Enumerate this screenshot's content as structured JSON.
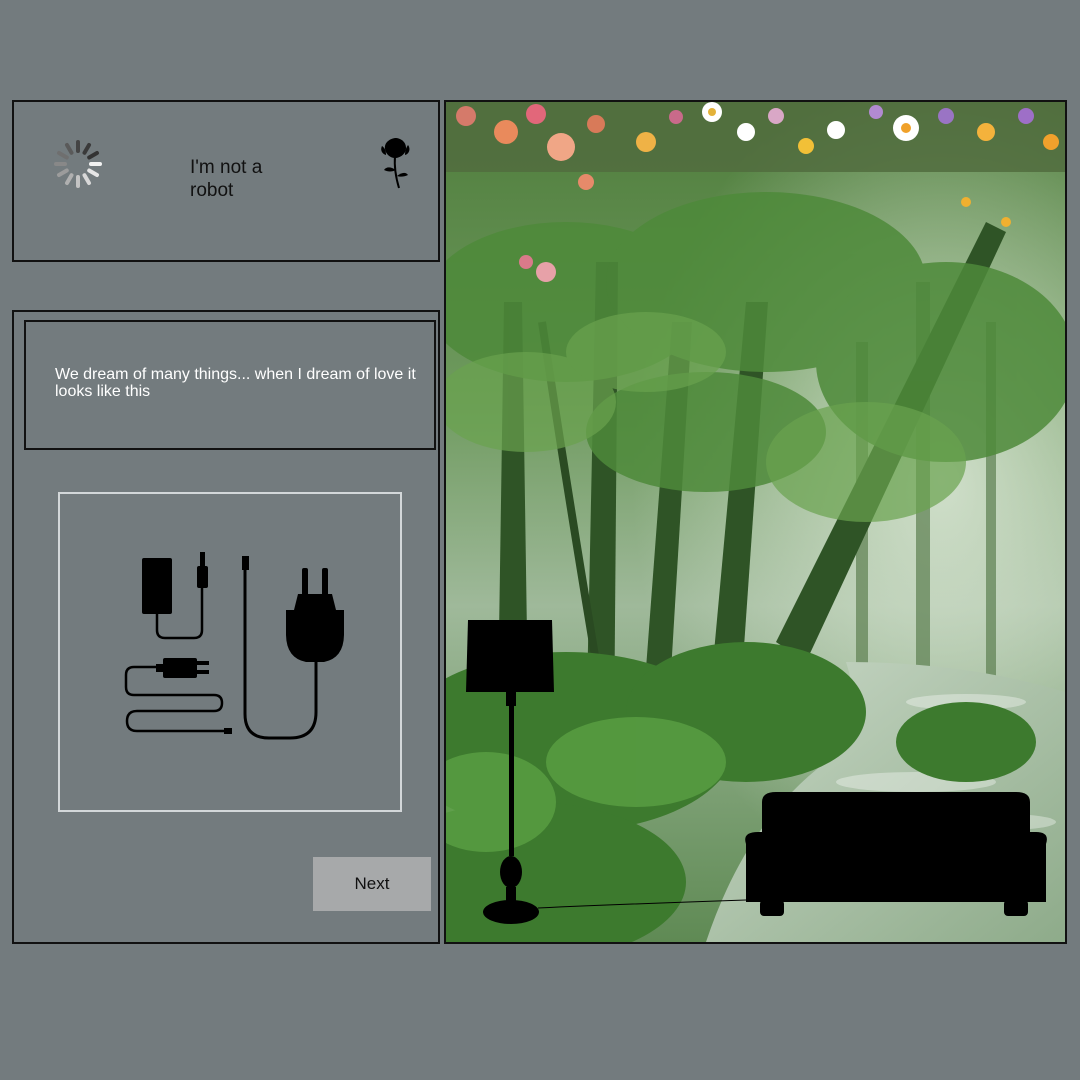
{
  "captcha": {
    "label": "I'm not a robot",
    "spinner_icon": "loading-spinner-icon",
    "flower_icon": "rose-icon"
  },
  "challenge": {
    "prompt": "We dream of many things... when I dream of love it looks like this",
    "tile_icon": "chargers-and-plug-icon",
    "next_label": "Next"
  },
  "scene": {
    "description_icons": [
      "floor-lamp-icon",
      "sofa-icon"
    ]
  },
  "colors": {
    "background": "#737b7e",
    "border": "#111111",
    "button": "#a7a9aa",
    "prompt_text": "#ffffff"
  }
}
